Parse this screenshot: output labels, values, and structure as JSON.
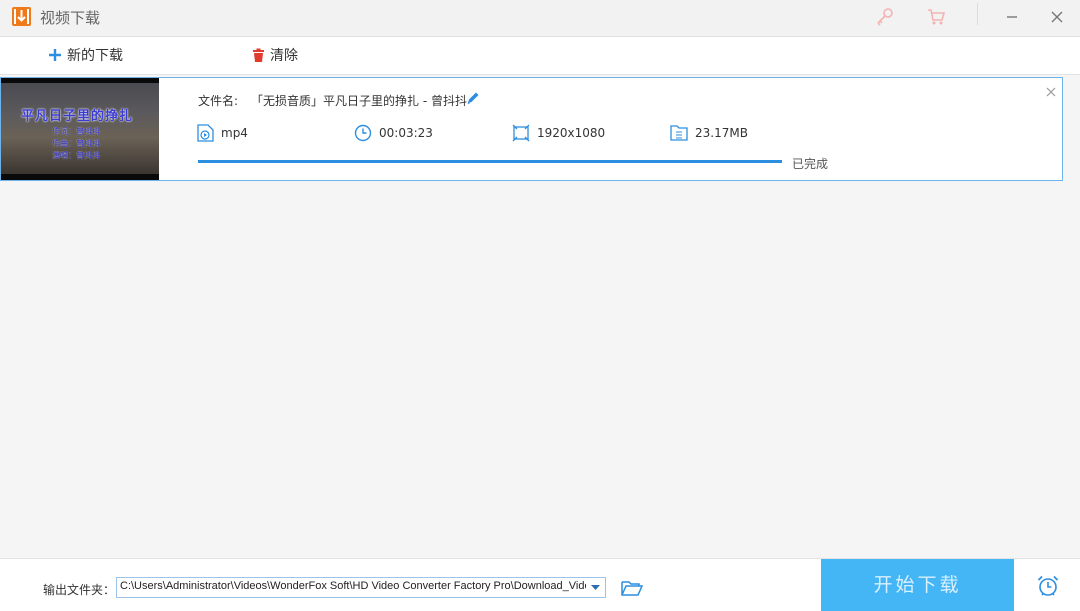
{
  "window": {
    "title": "视频下载",
    "icons": [
      "download-app-icon",
      "key-icon",
      "cart-icon",
      "minimize-icon",
      "close-icon"
    ]
  },
  "toolbar": {
    "new_download_label": "新的下载",
    "clear_label": "清除",
    "icons": [
      "plus-icon",
      "trash-icon"
    ]
  },
  "download_item": {
    "thumbnail": {
      "title": "平凡日子里的挣扎",
      "lines": [
        "作词：曾抖抖",
        "作曲：曾抖抖",
        "演唱：曾抖抖"
      ]
    },
    "filename_label": "文件名:",
    "filename": "「无损音质」平凡日子里的挣扎 - 曾抖抖",
    "format": "mp4",
    "duration": "00:03:23",
    "resolution": "1920x1080",
    "size": "23.17MB",
    "progress_percent": 100,
    "status": "已完成",
    "icons": [
      "edit-pencil-icon",
      "file-format-icon",
      "clock-icon",
      "resolution-icon",
      "file-size-icon",
      "remove-item-icon"
    ]
  },
  "footer": {
    "output_label": "输出文件夹：",
    "output_path": "C:\\Users\\Administrator\\Videos\\WonderFox Soft\\HD Video Converter Factory Pro\\Download_Video\\",
    "start_label": "开始下载",
    "icons": [
      "dropdown-arrow-icon",
      "open-folder-icon",
      "alarm-clock-icon"
    ]
  },
  "colors": {
    "accent": "#2c8ee0",
    "start_button": "#44b6f5",
    "clear_icon": "#e23a2c",
    "logo": "#f07a1a"
  }
}
